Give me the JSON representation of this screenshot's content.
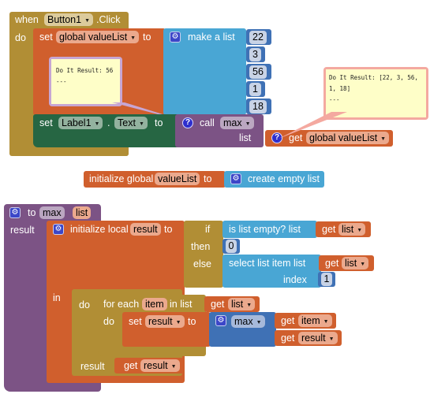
{
  "event_block": {
    "when": "when",
    "component": "Button1",
    "event": ".Click",
    "do": "do"
  },
  "set_global": {
    "set": "set",
    "variable": "global valueList",
    "to": "to",
    "make_list": "make a list",
    "items": [
      "22",
      "3",
      "56",
      "1",
      "18"
    ]
  },
  "bubble_left": {
    "line1": "Do It Result: 56",
    "line2": "---"
  },
  "set_label": {
    "set": "set",
    "component": "Label1",
    "dot": ".",
    "property": "Text",
    "to": "to",
    "call": "call",
    "procedure": "max",
    "list_label": "list",
    "get": "get",
    "get_variable": "global valueList"
  },
  "bubble_right": {
    "line1": "Do It Result: [22, 3, 56,",
    "line2": "1, 18]",
    "line3": "---"
  },
  "init_global": {
    "label": "initialize global",
    "name": "valueList",
    "to": "to",
    "value": "create empty list"
  },
  "procedure": {
    "to": "to",
    "name": "max",
    "param": "list",
    "result": "result",
    "init_local": "initialize local",
    "local_name": "result",
    "local_to": "to",
    "if": "if",
    "then": "then",
    "else": "else",
    "is_list_empty": "is list empty?  list",
    "get1": "get",
    "get1_var": "list",
    "then_value": "0",
    "select_item": "select list item  list",
    "get2": "get",
    "get2_var": "list",
    "index_label": "index",
    "index_value": "1",
    "in": "in",
    "do": "do",
    "for_each": "for each",
    "loop_var": "item",
    "in_list": "in list",
    "get3": "get",
    "get3_var": "list",
    "loop_do": "do",
    "set": "set",
    "set_var": "result",
    "set_to": "to",
    "max_op": "max",
    "get4": "get",
    "get4_var": "item",
    "get5": "get",
    "get5_var": "result",
    "result_label": "result",
    "get6": "get",
    "get6_var": "result"
  },
  "colors": {
    "event": "#b18e35",
    "variable": "#d05f2d",
    "list": "#49a6d4",
    "math": "#3f71b5",
    "component_setter": "#266643",
    "procedure": "#7c5385",
    "comment_bubble": "#fefec8"
  }
}
